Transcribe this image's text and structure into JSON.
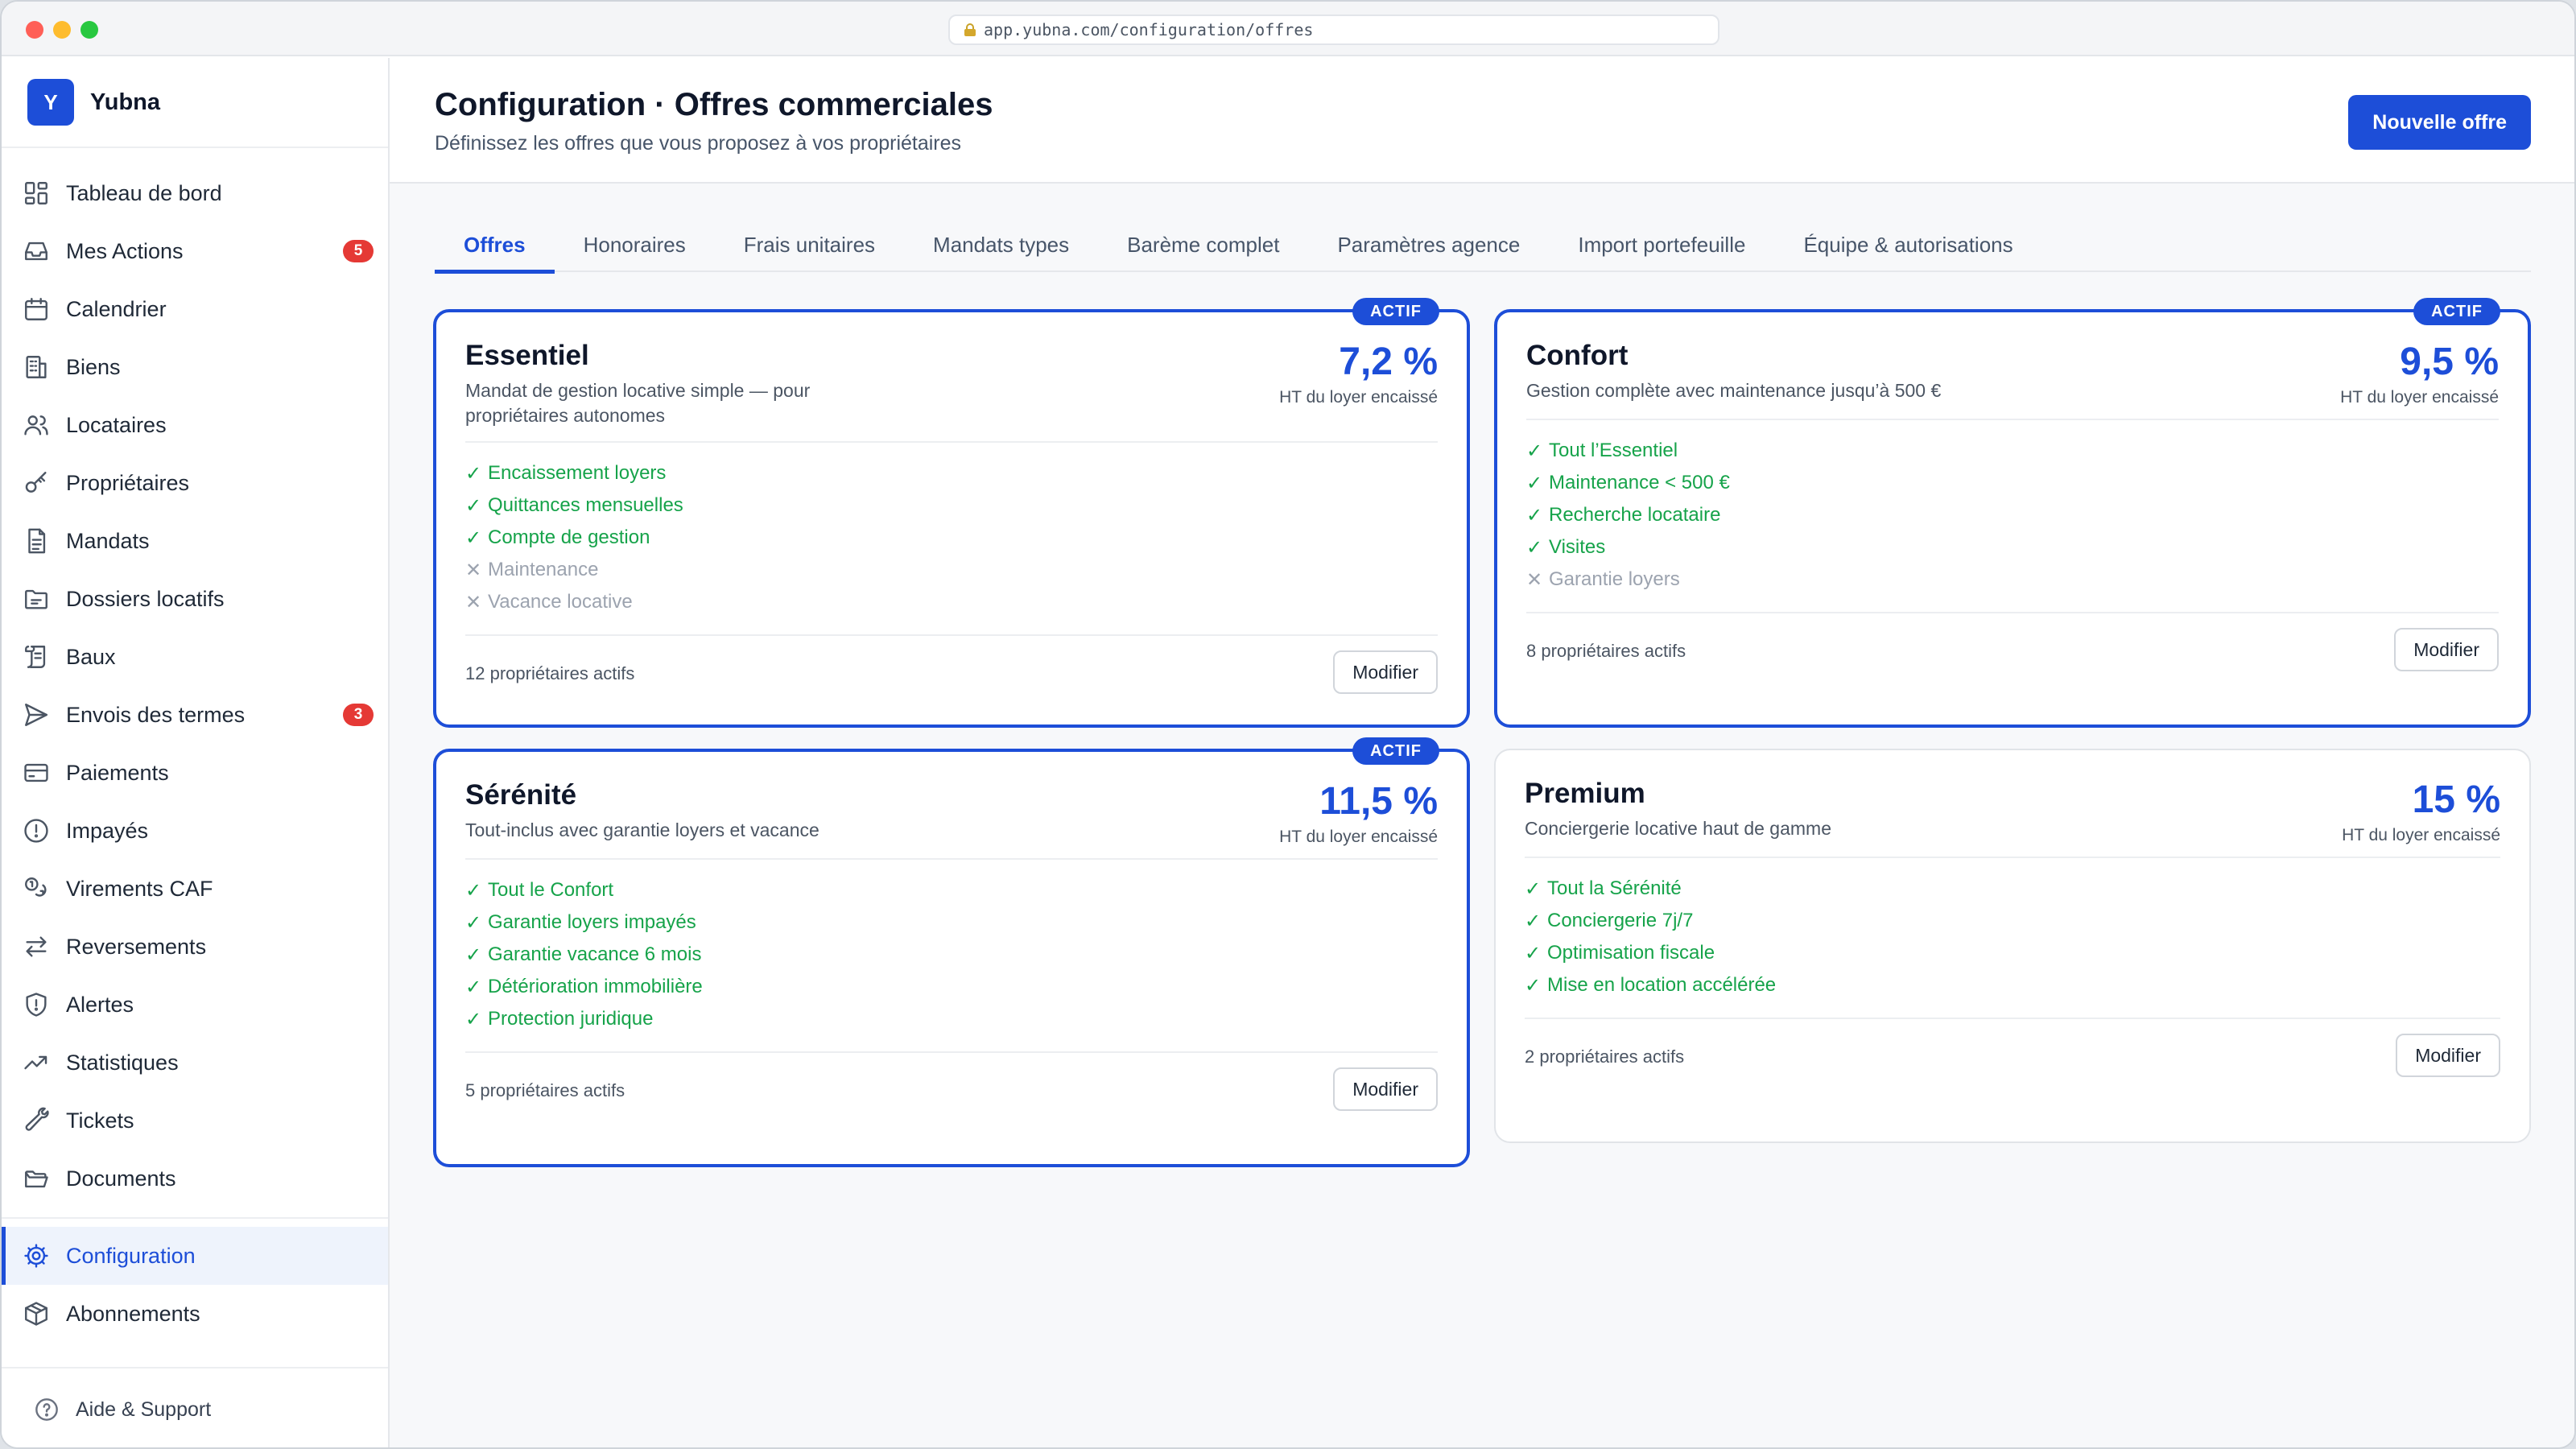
{
  "browser": {
    "url": "app.yubna.com/configuration/offres"
  },
  "brand": {
    "logo_letter": "Y",
    "name": "Yubna"
  },
  "sidebar": {
    "items": [
      {
        "label": "Tableau de bord",
        "icon": "dashboard-icon"
      },
      {
        "label": "Mes Actions",
        "icon": "inbox-icon",
        "badge": "5"
      },
      {
        "label": "Calendrier",
        "icon": "calendar-icon"
      },
      {
        "label": "Biens",
        "icon": "building-icon"
      },
      {
        "label": "Locataires",
        "icon": "users-icon"
      },
      {
        "label": "Propriétaires",
        "icon": "key-icon"
      },
      {
        "label": "Mandats",
        "icon": "document-icon"
      },
      {
        "label": "Dossiers locatifs",
        "icon": "folder-icon"
      },
      {
        "label": "Baux",
        "icon": "scroll-icon"
      },
      {
        "label": "Envois des termes",
        "icon": "send-icon",
        "badge": "3"
      },
      {
        "label": "Paiements",
        "icon": "credit-card-icon"
      },
      {
        "label": "Impayés",
        "icon": "alert-circle-icon"
      },
      {
        "label": "Virements CAF",
        "icon": "coins-icon"
      },
      {
        "label": "Reversements",
        "icon": "transfer-icon"
      },
      {
        "label": "Alertes",
        "icon": "shield-alert-icon"
      },
      {
        "label": "Statistiques",
        "icon": "trending-up-icon"
      },
      {
        "label": "Tickets",
        "icon": "wrench-icon"
      },
      {
        "label": "Documents",
        "icon": "folder-open-icon"
      }
    ],
    "bottom_items": [
      {
        "label": "Configuration",
        "icon": "gear-icon",
        "active": true
      },
      {
        "label": "Abonnements",
        "icon": "package-icon"
      }
    ],
    "support_label": "Aide & Support"
  },
  "header": {
    "title": "Configuration · Offres commerciales",
    "subtitle": "Définissez les offres que vous proposez à vos propriétaires",
    "new_button": "Nouvelle offre"
  },
  "tabs": [
    {
      "label": "Offres",
      "active": true
    },
    {
      "label": "Honoraires"
    },
    {
      "label": "Frais unitaires"
    },
    {
      "label": "Mandats types"
    },
    {
      "label": "Barème complet"
    },
    {
      "label": "Paramètres agence"
    },
    {
      "label": "Import portefeuille"
    },
    {
      "label": "Équipe & autorisations"
    }
  ],
  "offers": [
    {
      "name": "Essentiel",
      "description": "Mandat de gestion locative simple — pour propriétaires autonomes",
      "rate": "7,2 %",
      "rate_sub": "HT du loyer encaissé",
      "badge": "ACTIF",
      "features": [
        {
          "text": "Encaissement loyers",
          "included": true
        },
        {
          "text": "Quittances mensuelles",
          "included": true
        },
        {
          "text": "Compte de gestion",
          "included": true
        },
        {
          "text": "Maintenance",
          "included": false
        },
        {
          "text": "Vacance locative",
          "included": false
        }
      ],
      "owners": "12 propriétaires actifs",
      "modify": "Modifier"
    },
    {
      "name": "Confort",
      "description": "Gestion complète avec maintenance jusqu’à 500 €",
      "rate": "9,5 %",
      "rate_sub": "HT du loyer encaissé",
      "badge": "ACTIF",
      "features": [
        {
          "text": "Tout l’Essentiel",
          "included": true
        },
        {
          "text": "Maintenance < 500 €",
          "included": true
        },
        {
          "text": "Recherche locataire",
          "included": true
        },
        {
          "text": "Visites",
          "included": true
        },
        {
          "text": "Garantie loyers",
          "included": false
        }
      ],
      "owners": "8 propriétaires actifs",
      "modify": "Modifier"
    },
    {
      "name": "Sérénité",
      "description": "Tout-inclus avec garantie loyers et vacance",
      "rate": "11,5 %",
      "rate_sub": "HT du loyer encaissé",
      "badge": "ACTIF",
      "features": [
        {
          "text": "Tout le Confort",
          "included": true
        },
        {
          "text": "Garantie loyers impayés",
          "included": true
        },
        {
          "text": "Garantie vacance 6 mois",
          "included": true
        },
        {
          "text": "Détérioration immobilière",
          "included": true
        },
        {
          "text": "Protection juridique",
          "included": true
        }
      ],
      "owners": "5 propriétaires actifs",
      "modify": "Modifier"
    },
    {
      "name": "Premium",
      "description": "Conciergerie locative haut de gamme",
      "rate": "15 %",
      "rate_sub": "HT du loyer encaissé",
      "badge": "",
      "features": [
        {
          "text": "Tout la Sérénité",
          "included": true
        },
        {
          "text": "Conciergerie 7j/7",
          "included": true
        },
        {
          "text": "Optimisation fiscale",
          "included": true
        },
        {
          "text": "Mise en location accélérée",
          "included": true
        }
      ],
      "owners": "2 propriétaires actifs",
      "modify": "Modifier"
    }
  ],
  "marks": {
    "check": "✓",
    "cross": "✕"
  },
  "colors": {
    "accent": "#1d4ed8",
    "included": "#16a34a",
    "excluded": "#9ca3af",
    "badge": "#e53935"
  }
}
